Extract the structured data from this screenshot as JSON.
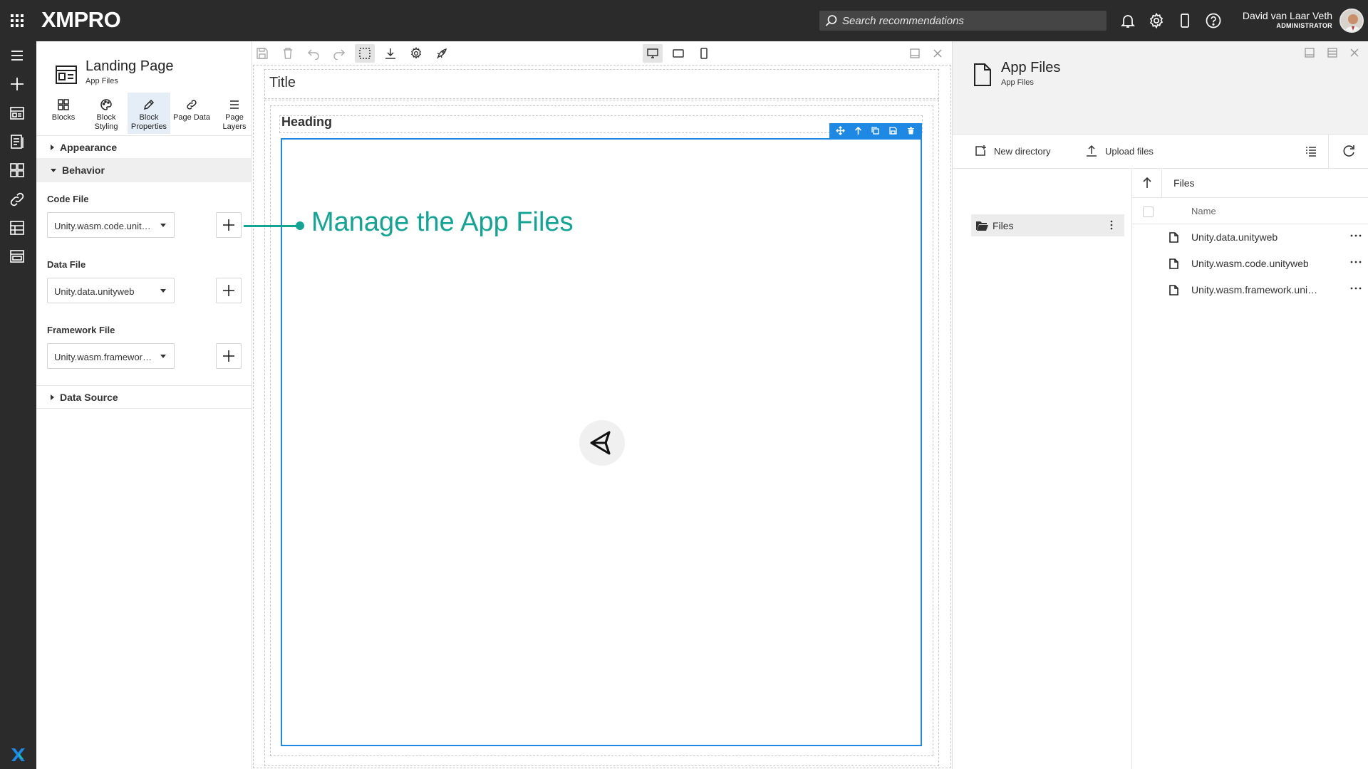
{
  "topbar": {
    "logo": "XMPRO",
    "search_placeholder": "Search recommendations",
    "user_name": "David van Laar Veth",
    "user_role": "ADMINISTRATOR"
  },
  "icons": {
    "apps": "grid-icon",
    "notifications": "bell-icon",
    "settings": "gear-icon",
    "mobile": "phone-icon",
    "help": "question-icon"
  },
  "properties_panel": {
    "title": "Landing Page",
    "subtitle": "App Files",
    "tabs": [
      {
        "label": "Blocks",
        "icon": "blocks-icon"
      },
      {
        "label": "Block Styling",
        "icon": "palette-icon"
      },
      {
        "label": "Block Properties",
        "icon": "pencil-icon",
        "active": true
      },
      {
        "label": "Page Data",
        "icon": "link-icon"
      },
      {
        "label": "Page Layers",
        "icon": "layers-icon"
      }
    ],
    "sections": {
      "appearance": "Appearance",
      "behavior": "Behavior",
      "data_source": "Data Source"
    },
    "fields": [
      {
        "label": "Code File",
        "value": "Unity.wasm.code.unityweb"
      },
      {
        "label": "Data File",
        "value": "Unity.data.unityweb"
      },
      {
        "label": "Framework File",
        "value": "Unity.wasm.framework.unityweb"
      }
    ]
  },
  "canvas": {
    "title_text": "Title",
    "heading_text": "Heading"
  },
  "callout": {
    "text": "Manage the App Files",
    "color": "#12a594"
  },
  "app_files": {
    "title": "App Files",
    "subtitle": "App Files",
    "toolbar": {
      "new_directory": "New directory",
      "upload_files": "Upload files"
    },
    "tree_root": "Files",
    "breadcrumb": "Files",
    "column_name": "Name",
    "files": [
      "Unity.data.unityweb",
      "Unity.wasm.code.unityweb",
      "Unity.wasm.framework.unityweb"
    ]
  },
  "colors": {
    "accent": "#1e88e5",
    "topbar": "#2b2b2b",
    "callout": "#12a594"
  }
}
